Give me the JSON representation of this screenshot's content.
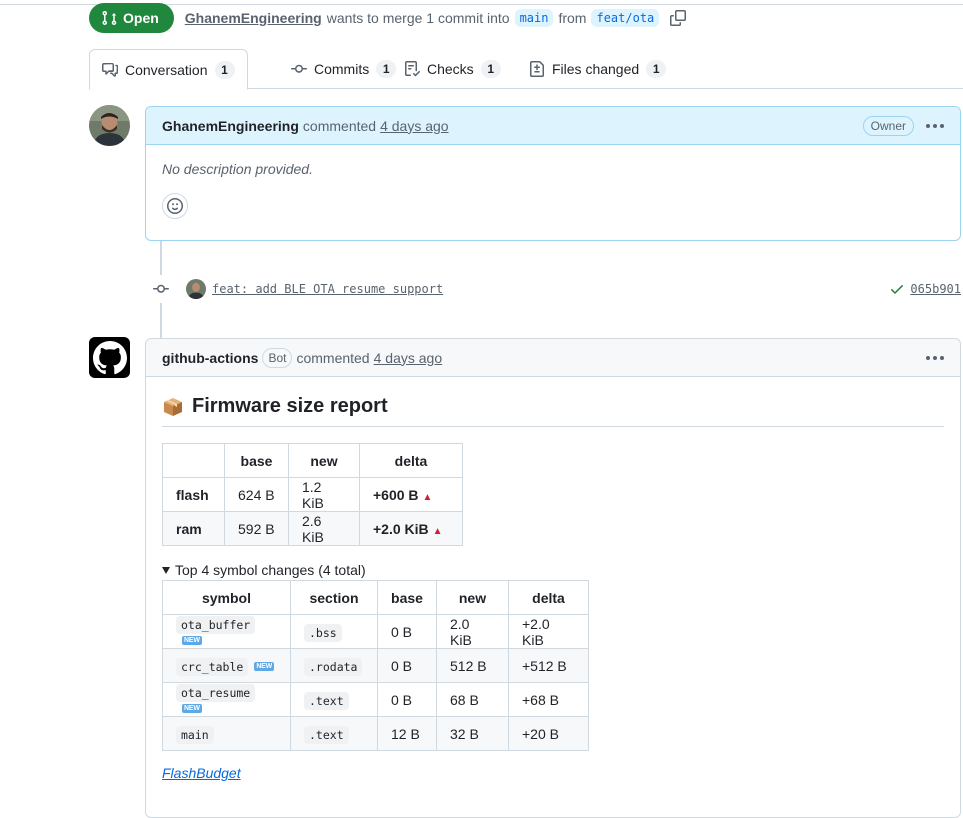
{
  "header": {
    "state": "Open",
    "author": "GhanemEngineering",
    "merge_text": "wants to merge 1 commit into",
    "base_branch": "main",
    "from_text": "from",
    "head_branch": "feat/ota"
  },
  "tabs": [
    {
      "label": "Conversation",
      "count": "1",
      "icon": "conversation-icon"
    },
    {
      "label": "Commits",
      "count": "1",
      "icon": "commit-icon"
    },
    {
      "label": "Checks",
      "count": "1",
      "icon": "checklist-icon"
    },
    {
      "label": "Files changed",
      "count": "1",
      "icon": "file-diff-icon"
    }
  ],
  "comment1": {
    "author": "GhanemEngineering",
    "action": "commented",
    "time": "4 days ago",
    "role": "Owner",
    "body": "No description provided."
  },
  "commit": {
    "message": "feat: add BLE OTA resume support",
    "sha": "065b901",
    "status_color": "#1a7f37"
  },
  "comment2": {
    "author": "github-actions",
    "badge": "Bot",
    "action": "commented",
    "time": "4 days ago",
    "title": "Firmware size report",
    "title_icon": "package-emoji",
    "size_table": {
      "headers": [
        "",
        "base",
        "new",
        "delta"
      ],
      "rows": [
        {
          "label": "flash",
          "base": "624 B",
          "new": "1.2 KiB",
          "delta": "+600 B"
        },
        {
          "label": "ram",
          "base": "592 B",
          "new": "2.6 KiB",
          "delta": "+2.0 KiB"
        }
      ]
    },
    "details_summary": "Top 4 symbol changes (4 total)",
    "symbol_table": {
      "headers": [
        "symbol",
        "section",
        "base",
        "new",
        "delta"
      ],
      "rows": [
        {
          "symbol": "ota_buffer",
          "new_badge": "NEW",
          "section": ".bss",
          "base": "0 B",
          "new": "2.0 KiB",
          "delta": "+2.0 KiB"
        },
        {
          "symbol": "crc_table",
          "new_badge": "NEW",
          "section": ".rodata",
          "base": "0 B",
          "new": "512 B",
          "delta": "+512 B"
        },
        {
          "symbol": "ota_resume",
          "new_badge": "NEW",
          "section": ".text",
          "base": "0 B",
          "new": "68 B",
          "delta": "+68 B"
        },
        {
          "symbol": "main",
          "new_badge": "",
          "section": ".text",
          "base": "12 B",
          "new": "32 B",
          "delta": "+20 B"
        }
      ]
    },
    "footer_link": "FlashBudget"
  },
  "colors": {
    "open_green": "#1f883d",
    "link_blue": "#0969da",
    "owner_header_bg": "#ddf4ff",
    "delta_red": "#cf222e"
  }
}
